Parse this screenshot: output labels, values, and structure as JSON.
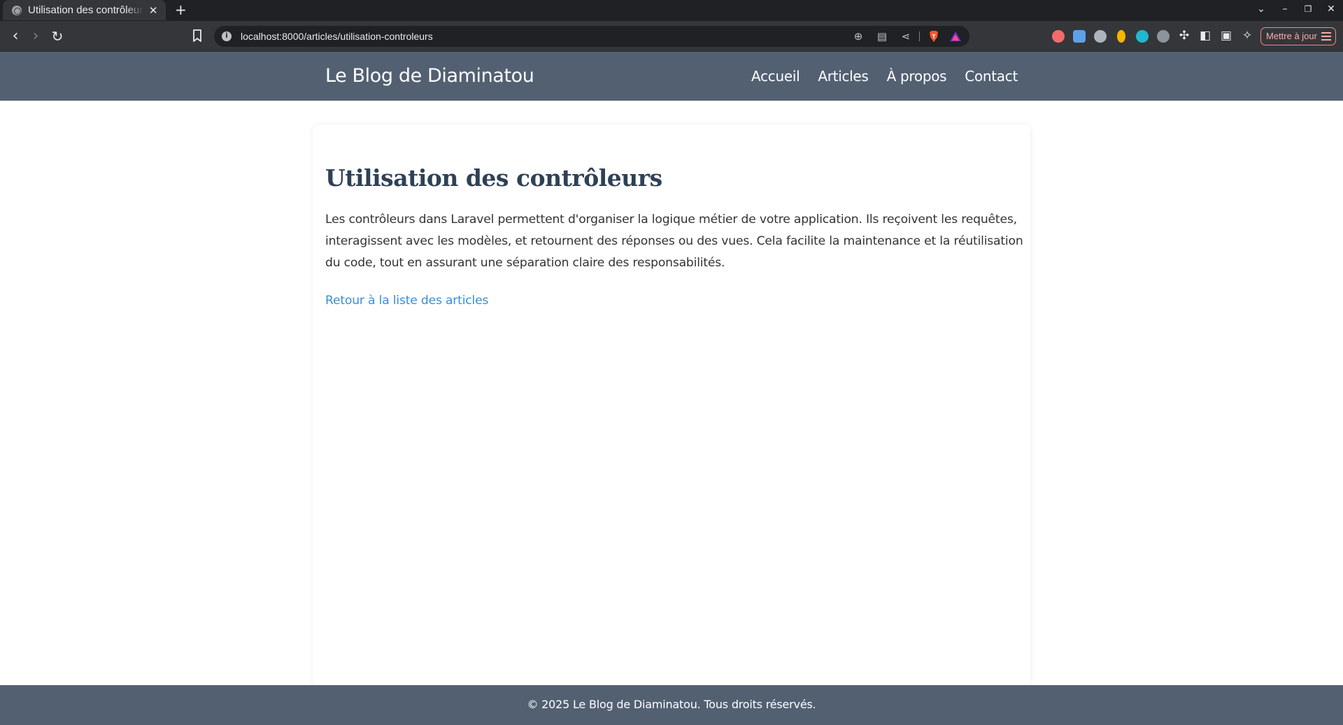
{
  "browser": {
    "tab": {
      "title": "Utilisation des contrôleurs",
      "close_glyph": "✕",
      "favicon": "globe-icon"
    },
    "new_tab_glyph": "+",
    "window_controls": {
      "tab_list": "⌄",
      "minimize": "–",
      "restore": "❐",
      "close": "✕"
    },
    "nav": {
      "back": "‹",
      "forward": "›",
      "reload": "↻"
    },
    "address": {
      "info_glyph": "i",
      "url": "localhost:8000/articles/utilisation-controleurs"
    },
    "omnibox_icons": [
      "zoom-icon",
      "reader-mode-icon",
      "share-icon",
      "brave-shields-icon",
      "brave-rewards-icon"
    ],
    "omnibox_glyphs": {
      "zoom": "⊕",
      "reader": "▤",
      "share": "⋖"
    },
    "extensions": [
      "extension-shield-red",
      "extension-camera",
      "extension-shield-grey",
      "extension-pin",
      "extension-download",
      "extension-vpn",
      "extensions-puzzle-icon",
      "sidebar-icon",
      "wallet-icon",
      "leo-ai-icon"
    ],
    "ext_glyphs": {
      "puzzle": "✣",
      "sidebar": "◧",
      "wallet": "▣",
      "leo": "✧"
    },
    "update_button_label": "Mettre à jour",
    "colors": {
      "tabbar": "#202124",
      "toolbar": "#35363a",
      "update_accent": "#f28b82"
    }
  },
  "site": {
    "title": "Le Blog de Diaminatou",
    "nav": [
      "Accueil",
      "Articles",
      "À propos",
      "Contact"
    ],
    "colors": {
      "header": "#526072",
      "title_text": "#2e4156",
      "link": "#3a8fd3"
    }
  },
  "article": {
    "title": "Utilisation des contrôleurs",
    "body": "Les contrôleurs dans Laravel permettent d'organiser la logique métier de votre application. Ils reçoivent les requêtes, interagissent avec les modèles, et retournent des réponses ou des vues. Cela facilite la maintenance et la réutilisation du code, tout en assurant une séparation claire des responsabilités.",
    "back_link": "Retour à la liste des articles"
  },
  "footer": {
    "text": "© 2025 Le Blog de Diaminatou. Tous droits réservés."
  }
}
